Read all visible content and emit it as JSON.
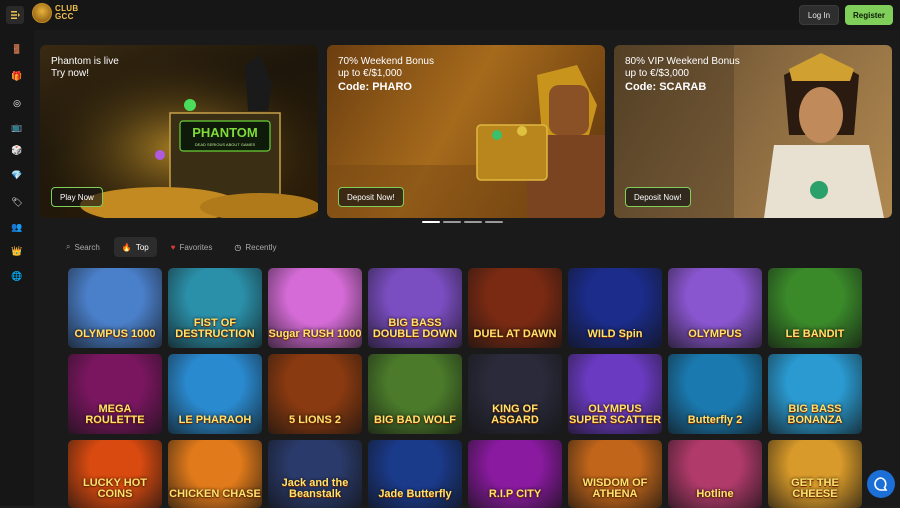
{
  "header": {
    "logo_line1": "CLUB",
    "logo_line2": "GCC",
    "login_label": "Log In",
    "register_label": "Register"
  },
  "sidebar": {
    "icons": [
      "door-icon",
      "gift-icon",
      "target-icon",
      "tv-icon",
      "dice-icon",
      "gem-icon",
      "tag-icon",
      "people-icon",
      "crown-icon",
      "globe-icon"
    ]
  },
  "banners": [
    {
      "title_line1": "Phantom is live",
      "title_line2": "Try now!",
      "code": "",
      "button": "Play Now",
      "art_text": "PHANTOM",
      "art_sub": "DEAD SERIOUS ABOUT GAMES"
    },
    {
      "title_line1": "70% Weekend Bonus",
      "title_line2": "up to €/$1,000",
      "code": "Code: PHARO",
      "button": "Deposit Now!"
    },
    {
      "title_line1": "80% VIP Weekend Bonus",
      "title_line2": "up to €/$3,000",
      "code": "Code: SCARAB",
      "button": "Deposit Now!"
    }
  ],
  "carousel": {
    "count": 4,
    "active": 0
  },
  "tabs": [
    {
      "label": "Search",
      "icon": "search-icon",
      "active": false
    },
    {
      "label": "Top",
      "icon": "fire-icon",
      "active": true
    },
    {
      "label": "Favorites",
      "icon": "heart-icon",
      "active": false
    },
    {
      "label": "Recently",
      "icon": "clock-icon",
      "active": false
    }
  ],
  "games": [
    {
      "label": "OLYMPUS 1000",
      "bg": "#4a7fc9"
    },
    {
      "label": "FIST OF DESTRUCTION",
      "bg": "#2a8fa8"
    },
    {
      "label": "Sugar RUSH 1000",
      "bg": "#d46bd6"
    },
    {
      "label": "BIG BASS DOUBLE DOWN",
      "bg": "#7a4dc0"
    },
    {
      "label": "DUEL AT DAWN",
      "bg": "#7a2a12"
    },
    {
      "label": "WILD Spin",
      "bg": "#1b2c8a"
    },
    {
      "label": "OLYMPUS",
      "bg": "#8a56d0"
    },
    {
      "label": "LE BANDIT",
      "bg": "#3a8a2a"
    },
    {
      "label": "MEGA ROULETTE",
      "bg": "#7a1660"
    },
    {
      "label": "LE PHARAOH",
      "bg": "#2a8acf"
    },
    {
      "label": "5 LIONS 2",
      "bg": "#8a3a10"
    },
    {
      "label": "BIG BAD WOLF",
      "bg": "#4a7a2a"
    },
    {
      "label": "KING OF ASGARD",
      "bg": "#2a2a3a"
    },
    {
      "label": "OLYMPUS SUPER SCATTER",
      "bg": "#6a3ac0"
    },
    {
      "label": "Butterfly 2",
      "bg": "#1a7ab0"
    },
    {
      "label": "BIG BASS BONANZA",
      "bg": "#2a9ad0"
    },
    {
      "label": "LUCKY HOT COINS",
      "bg": "#d84a10"
    },
    {
      "label": "CHICKEN CHASE",
      "bg": "#e07a1a"
    },
    {
      "label": "Jack and the Beanstalk",
      "bg": "#2a3a6a"
    },
    {
      "label": "Jade Butterfly",
      "bg": "#1a3a8a"
    },
    {
      "label": "R.I.P CITY",
      "bg": "#8a1aa0"
    },
    {
      "label": "WISDOM OF ATHENA",
      "bg": "#c0651a"
    },
    {
      "label": "Hotline",
      "bg": "#b03a6a"
    },
    {
      "label": "GET THE CHEESE",
      "bg": "#d89a2a"
    }
  ]
}
